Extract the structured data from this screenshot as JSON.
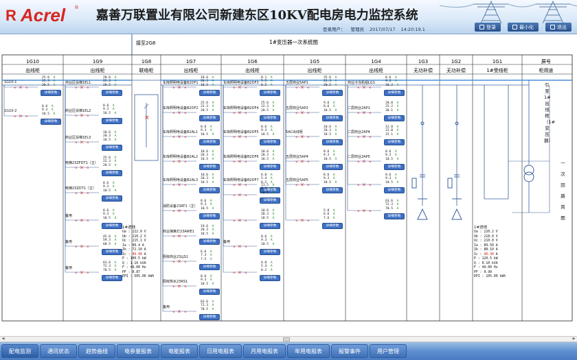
{
  "header": {
    "logo_r": "R",
    "logo_text": "Acrel",
    "logo_reg": "®",
    "title": "嘉善万联置业有限公司新建东区10KV配电房电力监控系统",
    "login_label": "登录用户：",
    "login_user": "管理员",
    "date": "2017/07/17",
    "time": "14:20:19.1",
    "buttons": [
      {
        "label": "登录",
        "icon": "user-icon"
      },
      {
        "label": "最小化",
        "icon": "minimize-icon"
      },
      {
        "label": "退出",
        "icon": "exit-icon"
      }
    ]
  },
  "diagram": {
    "label_jie": "接至2G8",
    "label_main": "1#变压器一次系统图",
    "cabinet_ids": [
      "1G10",
      "1G9",
      "1G8",
      "1G7",
      "1G6",
      "1G5",
      "1G4",
      "1G3",
      "1G2",
      "1G1",
      "屏号"
    ],
    "cabinet_types": [
      "出线柜",
      "出线柜",
      "联络柜",
      "出线柜",
      "出线柜",
      "出线柜",
      "出线柜",
      "无功补偿",
      "无功补偿",
      "1#受线柜",
      "柜用途"
    ],
    "detail_btn": "详细参数",
    "side_text": "引至1#出线柜（1#变压器）",
    "right_text": "一次回路简图",
    "colors": {
      "bus": "#4a8fd6",
      "breaker": "#d42020",
      "line": "#3a5f9e"
    }
  },
  "feeders": [
    {
      "col": 0,
      "name": "1G10-1",
      "v": [
        "25.6",
        "22.3",
        "20.5"
      ]
    },
    {
      "col": 0,
      "name": "1G10-2",
      "v": [
        "8.6",
        "9.3",
        "10.5"
      ]
    },
    {
      "col": 1,
      "name": "商业区扶梯1EL1",
      "v": [
        "20.6",
        "22.3",
        "20.5"
      ]
    },
    {
      "col": 1,
      "name": "商业区扶梯1EL2",
      "v": [
        "8.6",
        "9.3",
        "10.5"
      ]
    },
    {
      "col": 1,
      "name": "商业区扶梯1EL3",
      "v": [
        "10.6",
        "20.3",
        "18.5"
      ]
    },
    {
      "col": 1,
      "name": "电梯23ZFDT1（主）",
      "v": [
        "25.6",
        "22.3",
        "20.5"
      ]
    },
    {
      "col": 1,
      "name": "电梯23ZDT1（主）",
      "v": [
        "8.6",
        "9.3",
        "10.5"
      ]
    },
    {
      "col": 1,
      "name": "备用",
      "v": [
        "8.6",
        "9.3",
        "10.5"
      ]
    },
    {
      "col": 1,
      "name": "备用",
      "v": [
        "45.6",
        "59.3",
        "60.5"
      ]
    },
    {
      "col": 1,
      "name": "备用",
      "v": [
        "63.6",
        "72.3",
        "70.5"
      ]
    },
    {
      "col": 3,
      "name": "车库照明电设备B2DF1",
      "v": [
        "10.6",
        "20.3",
        "18.5"
      ]
    },
    {
      "col": 3,
      "name": "车库照明电设备B2DF2",
      "v": [
        "25.6",
        "22.3",
        "20.5"
      ]
    },
    {
      "col": 3,
      "name": "车库照明电设备B2AL1",
      "v": [
        "8.6",
        "9.3",
        "10.5"
      ]
    },
    {
      "col": 3,
      "name": "车库照明电设备B2AL2",
      "v": [
        "10.6",
        "20.3",
        "18.5"
      ]
    },
    {
      "col": 3,
      "name": "车库照明电设备B2AL3",
      "v": [
        "10.6",
        "20.3",
        "18.5"
      ]
    },
    {
      "col": 3,
      "name": "消防设备23AT1（主）",
      "v": [
        "8.6",
        "9.3",
        "10.5"
      ]
    },
    {
      "col": 3,
      "name": "商业弹簧灯23AWE1",
      "v": [
        "19.6",
        "20.3",
        "18.5"
      ]
    },
    {
      "col": 3,
      "name": "厨房商业23LJS1",
      "v": [
        "6.6",
        "7.3",
        "7.5"
      ]
    },
    {
      "col": 3,
      "name": "厨房热水23RS1",
      "v": [
        "8.6",
        "9.3",
        "10.5"
      ]
    },
    {
      "col": 3,
      "name": "备用",
      "v": [
        "63.6",
        "72.3",
        "70.5"
      ]
    },
    {
      "col": 4,
      "name": "车库照明电设备B2DF3",
      "v": [
        "8.1",
        "5.5",
        "8.5"
      ]
    },
    {
      "col": 4,
      "name": "车库照明电设备B2DF4",
      "v": [
        "25.6",
        "22.3",
        "20.5"
      ]
    },
    {
      "col": 4,
      "name": "车库照明电设备B2DF5",
      "v": [
        "8.6",
        "9.3",
        "10.5"
      ]
    },
    {
      "col": 4,
      "name": "车库照明电设备B2DF6",
      "v": [
        "10.6",
        "20.3",
        "18.5"
      ]
    },
    {
      "col": 4,
      "name": "车库照明电设备B2DF7",
      "v": [
        "6.0",
        "5.4",
        "8.2"
      ]
    },
    {
      "col": 4,
      "name": "",
      "v": [
        "11.5",
        "9.3",
        "10.5"
      ]
    },
    {
      "col": 4,
      "name": "",
      "v": [
        "10.6",
        "20.3",
        "18.5"
      ]
    },
    {
      "col": 4,
      "name": "备用",
      "v": [
        "8.6",
        "9.3",
        "10.5"
      ]
    },
    {
      "col": 4,
      "name": "",
      "v": [
        "6.0",
        "5.4",
        "8.2"
      ]
    },
    {
      "col": 5,
      "name": "五层商业5AP1",
      "v": [
        "25.6",
        "22.3",
        "20.5"
      ]
    },
    {
      "col": 5,
      "name": "五层商业5AP2",
      "v": [
        "9.6",
        "8.6",
        "10.5"
      ]
    },
    {
      "col": 5,
      "name": "5AC出线柜",
      "v": [
        "10.6",
        "20.3",
        "18.5"
      ]
    },
    {
      "col": 5,
      "name": "五层商业5AP4",
      "v": [
        "8.6",
        "9.3",
        "10.5"
      ]
    },
    {
      "col": 5,
      "name": "五层商业5AP5",
      "v": [
        "8.6",
        "9.3",
        "10.5"
      ]
    },
    {
      "col": 5,
      "name": "",
      "v": [
        "5.8",
        "6.6",
        "7.6"
      ]
    },
    {
      "col": 6,
      "name": "商业冷冻机组LG1",
      "v": [
        "8.6",
        "9.3",
        "10.2"
      ]
    },
    {
      "col": 6,
      "name": "二层商业2AP1",
      "v": [
        "20.0",
        "25.2",
        "30.1"
      ]
    },
    {
      "col": 6,
      "name": "二层商业2AP4",
      "v": [
        "12.0",
        "22.0",
        "15.1"
      ]
    },
    {
      "col": 6,
      "name": "二层商业2AP5",
      "v": [
        "8.6",
        "9.3",
        "10.5"
      ]
    },
    {
      "col": 6,
      "name": "",
      "v": [
        "8.6",
        "9.3",
        "10.5"
      ]
    },
    {
      "col": 6,
      "name": "",
      "v": [
        "63.6",
        "72.3",
        "70.5"
      ]
    }
  ],
  "incomers": [
    {
      "id": "1G8",
      "title": "1#进线",
      "ua": "222.0",
      "ub": "210.2",
      "uc": "215.1",
      "ia": "90.4",
      "ib": "72.10",
      "ic": "96.90",
      "p": "100.5",
      "q": "1.10",
      "f": "49.00",
      "pf": "0.87",
      "epi": "505.00"
    },
    {
      "id": "1G1",
      "title": "1#进线",
      "ua": "220.2",
      "ub": "218.0",
      "uc": "210.0",
      "ia": "89.50",
      "ib": "88.10",
      "ic": "90.30",
      "p": "120.5",
      "q": "0.10",
      "f": "49.00",
      "pf": "0.90",
      "epi": "105.00"
    }
  ],
  "units": {
    "v": "V",
    "a": "A",
    "p": "kW",
    "q": "kVA",
    "f": "Hz",
    "epi": "kWh"
  },
  "labels": {
    "ua": "Ua",
    "ub": "Ub",
    "uc": "Uc",
    "ia": "Ia",
    "ib": "Ib",
    "ic": "Ic",
    "p": "P",
    "q": "Q",
    "f": "F",
    "pf": "PF",
    "epi": "EPI"
  },
  "phase_unit": "A",
  "nav": [
    "配电监测",
    "通讯状态",
    "趋势曲线",
    "电参量报表",
    "电能报表",
    "日用电报表",
    "月用电报表",
    "年用电报表",
    "报警事件",
    "用户管理"
  ]
}
